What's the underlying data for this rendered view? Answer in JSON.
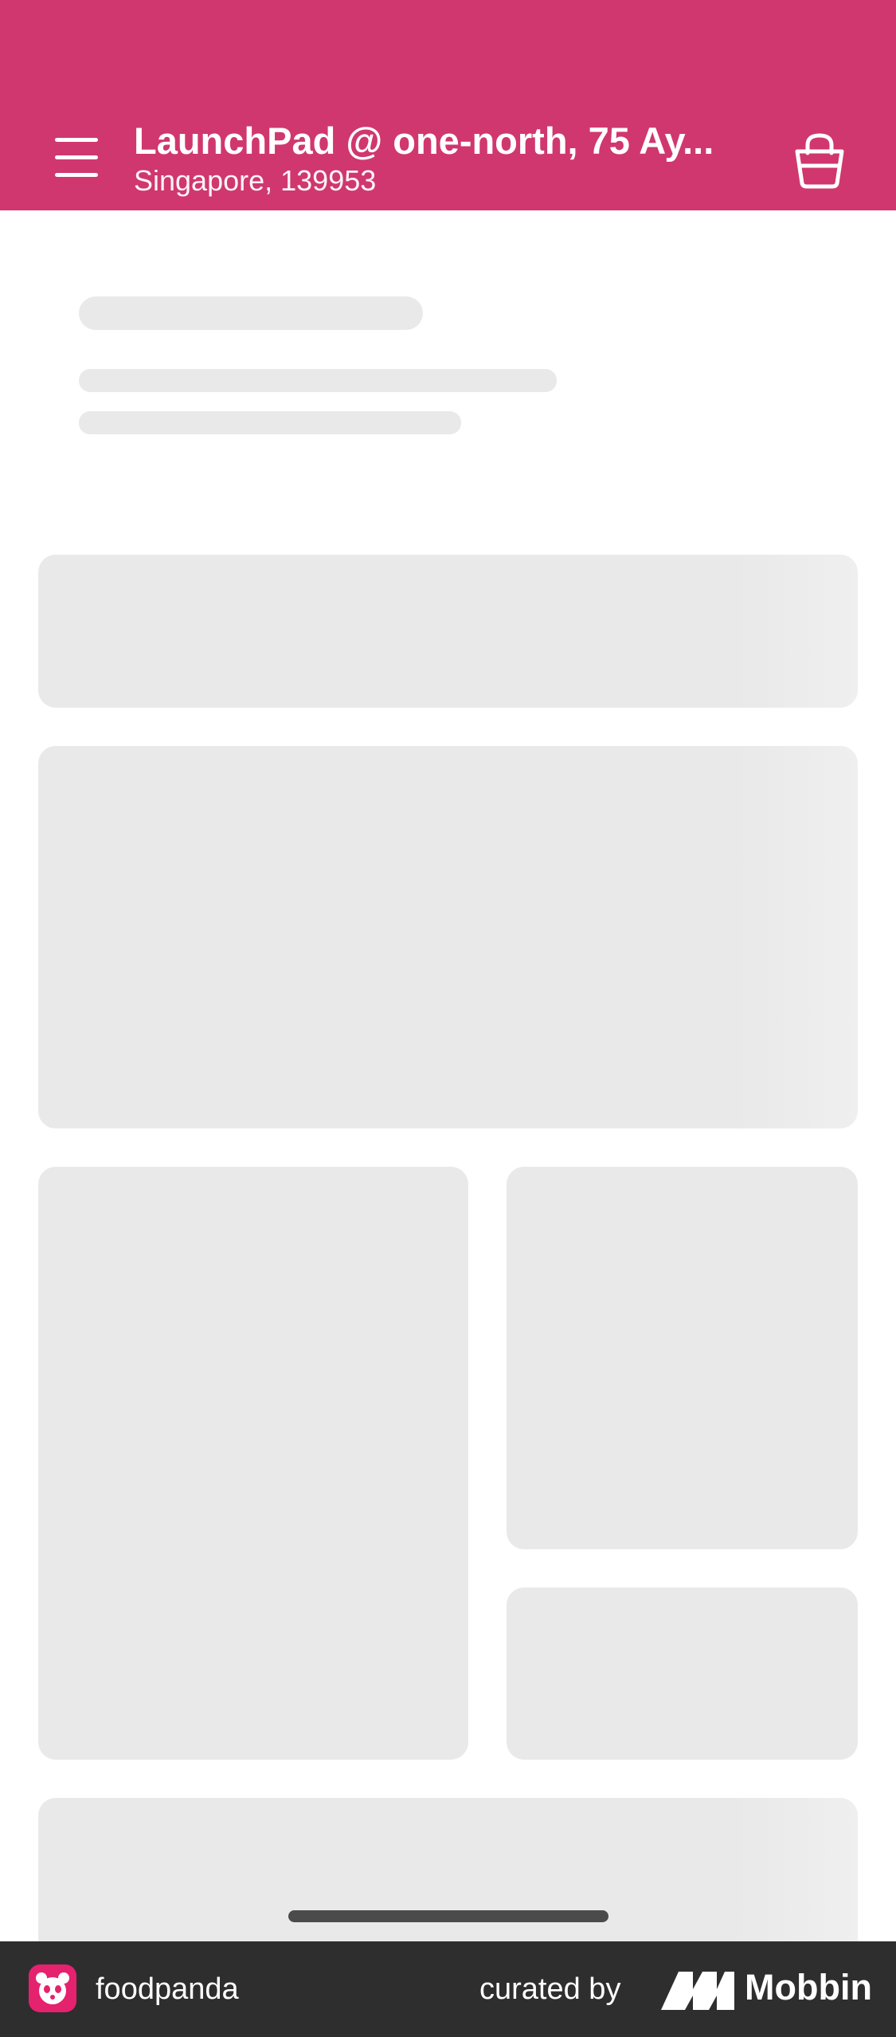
{
  "header": {
    "background": "#d0376f",
    "address_title": "LaunchPad @ one-north, 75 Ay...",
    "address_subtitle": "Singapore, 139953",
    "menu_icon": "hamburger-menu-icon",
    "cart_icon": "shopping-bag-icon"
  },
  "footer": {
    "brand_name": "foodpanda",
    "curated_label": "curated by",
    "curator_name": "Mobbin"
  }
}
